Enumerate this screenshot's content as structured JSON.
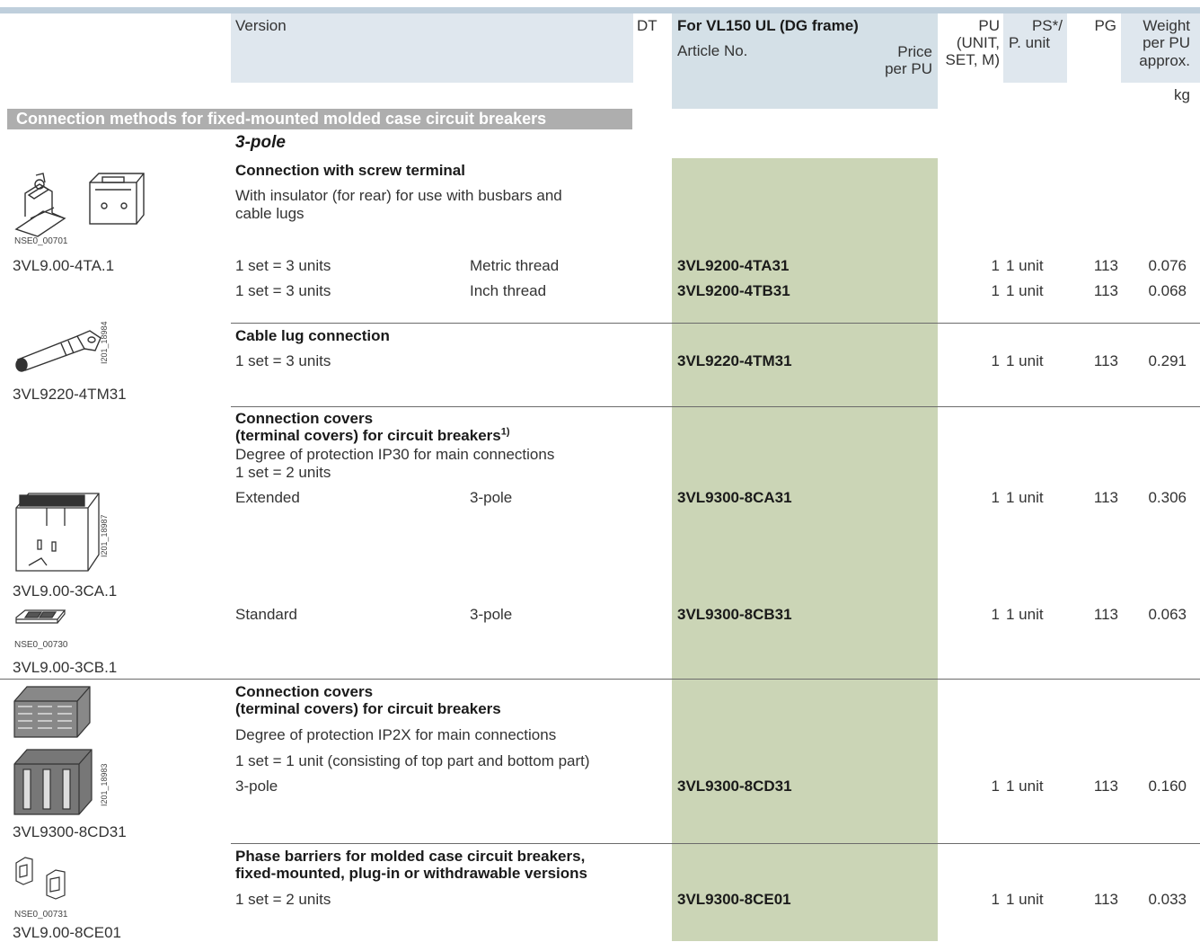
{
  "header": {
    "version": "Version",
    "dt": "DT",
    "for_label": "For VL150 UL (DG frame)",
    "article_no": "Article No.",
    "price_l1": "Price",
    "price_l2": "per PU",
    "pu_l1": "PU",
    "pu_l2": "(UNIT,",
    "pu_l3": "SET, M)",
    "ps_l1": "PS*/",
    "ps_l2": "P. unit",
    "pg": "PG",
    "weight_l1": "Weight",
    "weight_l2": "per PU",
    "weight_l3": "approx.",
    "kg": "kg"
  },
  "section_title": "Connection methods for fixed-mounted molded case circuit breakers",
  "subsection": "3-pole",
  "groups": [
    {
      "title": "Connection with screw terminal",
      "desc": "With insulator (for rear) for use with busbars and",
      "desc2": "cable lugs",
      "image_code": "NSE0_00701",
      "caption": "3VL9.00-4TA.1",
      "icon": "screw-terminal-icon",
      "rows": [
        {
          "version": "1 set = 3 units",
          "variant": "Metric thread",
          "article": "3VL9200-4TA31",
          "pu": "1",
          "ps": "1 unit",
          "pg": "113",
          "weight": "0.076"
        },
        {
          "version": "1 set = 3 units",
          "variant": "Inch thread",
          "article": "3VL9200-4TB31",
          "pu": "1",
          "ps": "1 unit",
          "pg": "113",
          "weight": "0.068"
        }
      ]
    },
    {
      "title": "Cable lug connection",
      "image_code": "I201_18984",
      "caption": "3VL9220-4TM31",
      "icon": "cable-lug-icon",
      "rows": [
        {
          "version": "1 set = 3 units",
          "article": "3VL9220-4TM31",
          "pu": "1",
          "ps": "1 unit",
          "pg": "113",
          "weight": "0.291"
        }
      ]
    },
    {
      "title_l1": "Connection covers",
      "title_l2": "(terminal covers) for circuit breakers",
      "footnote": "1)",
      "desc": "Degree of protection IP30 for main connections",
      "desc2": "1 set = 2 units",
      "image_code": "I201_18987",
      "caption": "3VL9.00-3CA.1",
      "image_code_2": "NSE0_00730",
      "caption_2": "3VL9.00-3CB.1",
      "icon": "terminal-cover-extended-icon",
      "icon_2": "terminal-cover-standard-icon",
      "rows": [
        {
          "version": "Extended",
          "variant": "3-pole",
          "article": "3VL9300-8CA31",
          "pu": "1",
          "ps": "1 unit",
          "pg": "113",
          "weight": "0.306"
        },
        {
          "version": "Standard",
          "variant": "3-pole",
          "article": "3VL9300-8CB31",
          "pu": "1",
          "ps": "1 unit",
          "pg": "113",
          "weight": "0.063"
        }
      ]
    },
    {
      "title_l1": "Connection covers",
      "title_l2": "(terminal covers) for circuit breakers",
      "desc": "Degree of protection IP2X for main connections",
      "desc2": "1 set = 1 unit (consisting of top part and bottom part)",
      "image_code": "I201_18983",
      "caption": "3VL9300-8CD31",
      "icon": "terminal-cover-ip2x-icon",
      "rows": [
        {
          "version": "3-pole",
          "article": "3VL9300-8CD31",
          "pu": "1",
          "ps": "1 unit",
          "pg": "113",
          "weight": "0.160"
        }
      ]
    },
    {
      "title_l1": "Phase barriers for molded case circuit breakers,",
      "title_l2": "fixed-mounted, plug-in or withdrawable versions",
      "image_code": "NSE0_00731",
      "caption": "3VL9.00-8CE01",
      "icon": "phase-barrier-icon",
      "rows": [
        {
          "version": "1 set = 2 units",
          "article": "3VL9300-8CE01",
          "pu": "1",
          "ps": "1 unit",
          "pg": "113",
          "weight": "0.033"
        }
      ]
    }
  ]
}
